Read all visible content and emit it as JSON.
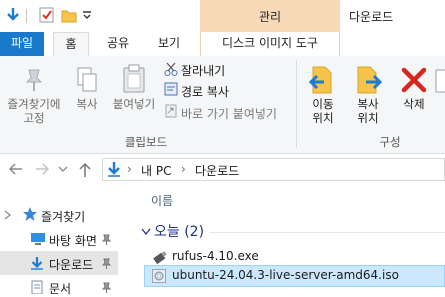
{
  "window": {
    "title": "다운로드",
    "context_group": "관리"
  },
  "tabs": {
    "file": "파일",
    "home": "홈",
    "share": "공유",
    "view": "보기",
    "disk_tools": "디스크 이미지 도구"
  },
  "ribbon": {
    "pin_label_1": "즐겨찾기에",
    "pin_label_2": "고정",
    "copy": "복사",
    "paste": "붙여넣기",
    "cut": "잘라내기",
    "copy_path": "경로 복사",
    "paste_shortcut": "바로 가기 붙여넣기",
    "clipboard_group": "클립보드",
    "move_to_1": "이동",
    "move_to_2": "위치",
    "copy_to_1": "복사",
    "copy_to_2": "위치",
    "delete": "삭제",
    "organize_group": "구성"
  },
  "address": {
    "crumb_pc": "내 PC",
    "crumb_folder": "다운로드",
    "sep": "›"
  },
  "nav": {
    "quick_access": "즐겨찾기",
    "desktop": "바탕 화면",
    "downloads": "다운로드",
    "documents": "문서"
  },
  "list": {
    "column_name": "이름",
    "group_today": "오늘 (2)",
    "files": [
      "rufus-4.10.exe",
      "ubuntu-24.04.3-live-server-amd64.iso"
    ]
  },
  "colors": {
    "accent": "#1979ca",
    "context": "#f8d9b8",
    "selection": "#cce8ff"
  }
}
